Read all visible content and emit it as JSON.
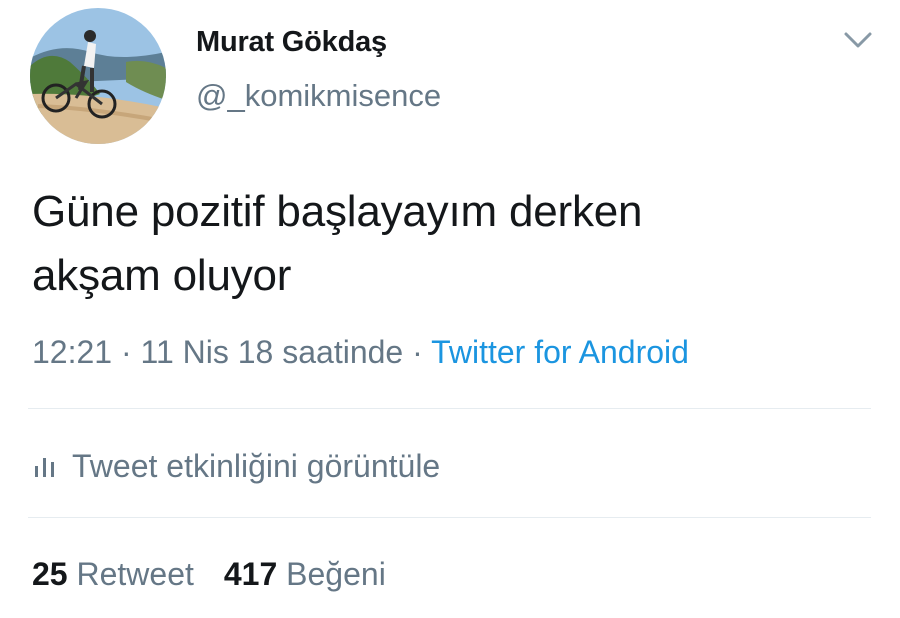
{
  "user": {
    "display_name": "Murat Gökdaş",
    "handle": "@_komikmisence",
    "avatar_icon": "avatar-photo-cyclist"
  },
  "tweet": {
    "text": "Güne pozitif başlayayım derken\nakşam oluyor",
    "time": "12:21",
    "date": "11 Nis 18 saatinde",
    "separator": "·",
    "source": "Twitter for Android"
  },
  "activity": {
    "label": "Tweet etkinliğini görüntüle",
    "icon": "bar-chart-icon"
  },
  "stats": {
    "retweets_count": "25",
    "retweets_label": "Retweet",
    "likes_count": "417",
    "likes_label": "Beğeni"
  },
  "colors": {
    "text": "#14171a",
    "secondary": "#657786",
    "link": "#1b95e0",
    "divider": "#e6ecf0"
  }
}
